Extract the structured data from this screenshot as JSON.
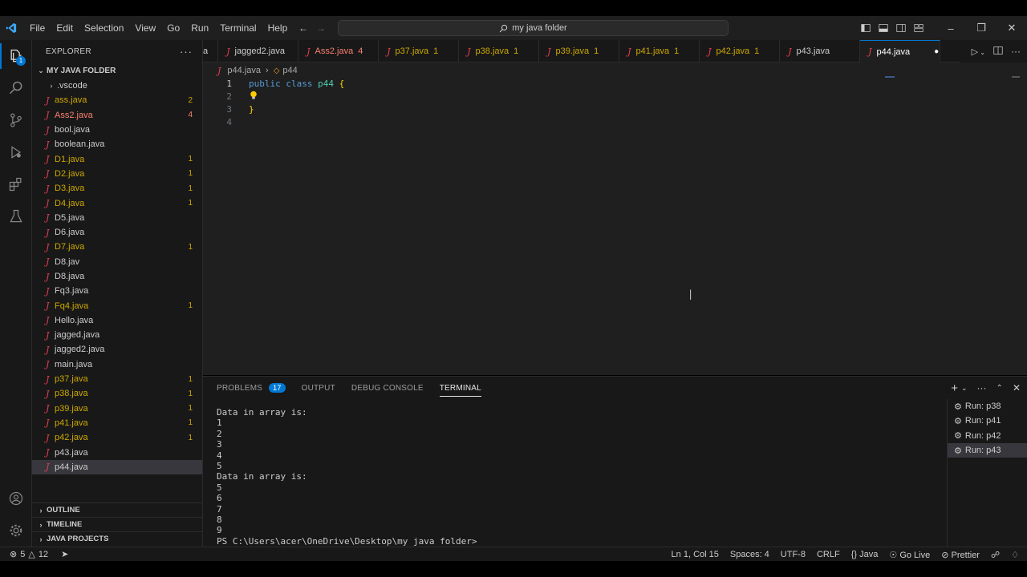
{
  "menu": [
    "File",
    "Edit",
    "Selection",
    "View",
    "Go",
    "Run",
    "Terminal",
    "Help"
  ],
  "search": {
    "text": "my java folder"
  },
  "activity": {
    "explorer_badge": "1"
  },
  "sidebar": {
    "title": "EXPLORER",
    "folder": "MY JAVA FOLDER",
    "items": [
      {
        "name": ".vscode",
        "type": "folder",
        "color": "white",
        "count": ""
      },
      {
        "name": "ass.java",
        "type": "java",
        "color": "yellow",
        "count": "2"
      },
      {
        "name": "Ass2.java",
        "type": "java",
        "color": "red",
        "count": "4"
      },
      {
        "name": "bool.java",
        "type": "java",
        "color": "white",
        "count": ""
      },
      {
        "name": "boolean.java",
        "type": "java",
        "color": "white",
        "count": ""
      },
      {
        "name": "D1.java",
        "type": "java",
        "color": "yellow",
        "count": "1"
      },
      {
        "name": "D2.java",
        "type": "java",
        "color": "yellow",
        "count": "1"
      },
      {
        "name": "D3.java",
        "type": "java",
        "color": "yellow",
        "count": "1"
      },
      {
        "name": "D4.java",
        "type": "java",
        "color": "yellow",
        "count": "1"
      },
      {
        "name": "D5.java",
        "type": "java",
        "color": "white",
        "count": ""
      },
      {
        "name": "D6.java",
        "type": "java",
        "color": "white",
        "count": ""
      },
      {
        "name": "D7.java",
        "type": "java",
        "color": "yellow",
        "count": "1"
      },
      {
        "name": "D8.jav",
        "type": "java",
        "color": "white",
        "count": ""
      },
      {
        "name": "D8.java",
        "type": "java",
        "color": "white",
        "count": ""
      },
      {
        "name": "Fq3.java",
        "type": "java",
        "color": "white",
        "count": ""
      },
      {
        "name": "Fq4.java",
        "type": "java",
        "color": "yellow",
        "count": "1"
      },
      {
        "name": "Hello.java",
        "type": "java",
        "color": "white",
        "count": ""
      },
      {
        "name": "jagged.java",
        "type": "java",
        "color": "white",
        "count": ""
      },
      {
        "name": "jagged2.java",
        "type": "java",
        "color": "white",
        "count": ""
      },
      {
        "name": "main.java",
        "type": "java",
        "color": "white",
        "count": ""
      },
      {
        "name": "p37.java",
        "type": "java",
        "color": "yellow",
        "count": "1"
      },
      {
        "name": "p38.java",
        "type": "java",
        "color": "yellow",
        "count": "1"
      },
      {
        "name": "p39.java",
        "type": "java",
        "color": "yellow",
        "count": "1"
      },
      {
        "name": "p41.java",
        "type": "java",
        "color": "yellow",
        "count": "1"
      },
      {
        "name": "p42.java",
        "type": "java",
        "color": "yellow",
        "count": "1"
      },
      {
        "name": "p43.java",
        "type": "java",
        "color": "white",
        "count": ""
      },
      {
        "name": "p44.java",
        "type": "java",
        "color": "white",
        "count": "",
        "selected": true
      }
    ],
    "sections": [
      "OUTLINE",
      "TIMELINE",
      "JAVA PROJECTS"
    ]
  },
  "tabs": [
    {
      "label": "jagged2.java",
      "badge": "",
      "color": "white",
      "j": true,
      "trunc": "a"
    },
    {
      "label": "Ass2.java",
      "badge": "4",
      "color": "red"
    },
    {
      "label": "p37.java",
      "badge": "1",
      "color": "yellow"
    },
    {
      "label": "p38.java",
      "badge": "1",
      "color": "yellow"
    },
    {
      "label": "p39.java",
      "badge": "1",
      "color": "yellow"
    },
    {
      "label": "p41.java",
      "badge": "1",
      "color": "yellow"
    },
    {
      "label": "p42.java",
      "badge": "1",
      "color": "yellow"
    },
    {
      "label": "p43.java",
      "badge": "",
      "color": "white"
    },
    {
      "label": "p44.java",
      "badge": "",
      "color": "white",
      "active": true
    }
  ],
  "breadcrumb": {
    "file": "p44.java",
    "symbol": "p44"
  },
  "editor": {
    "lines": [
      {
        "num": "1",
        "kw1": "public",
        "kw2": "class",
        "cls": "p44",
        "brace": "{"
      },
      {
        "num": "2"
      },
      {
        "num": "3",
        "brace": "}"
      },
      {
        "num": "4"
      }
    ]
  },
  "panel": {
    "tabs": [
      "PROBLEMS",
      "OUTPUT",
      "DEBUG CONSOLE",
      "TERMINAL"
    ],
    "problems_count": "17",
    "terminal_lines": [
      "Data in array is:",
      "1",
      "2",
      "3",
      "4",
      "5",
      "Data in array is:",
      "5",
      "6",
      "7",
      "8",
      "9",
      "PS C:\\Users\\acer\\OneDrive\\Desktop\\my java folder>"
    ],
    "terminals": [
      "Run: p38",
      "Run: p41",
      "Run: p42",
      "Run: p43"
    ]
  },
  "status": {
    "errors": "5",
    "warnings": "12",
    "position": "Ln 1, Col 15",
    "spaces": "Spaces: 4",
    "encoding": "UTF-8",
    "eol": "CRLF",
    "language": "Java",
    "golive": "Go Live",
    "prettier": "Prettier"
  },
  "colors": {
    "accent": "#0078d4",
    "warning": "#cca700",
    "error": "#f88070",
    "java_icon": "#e03e4f"
  }
}
